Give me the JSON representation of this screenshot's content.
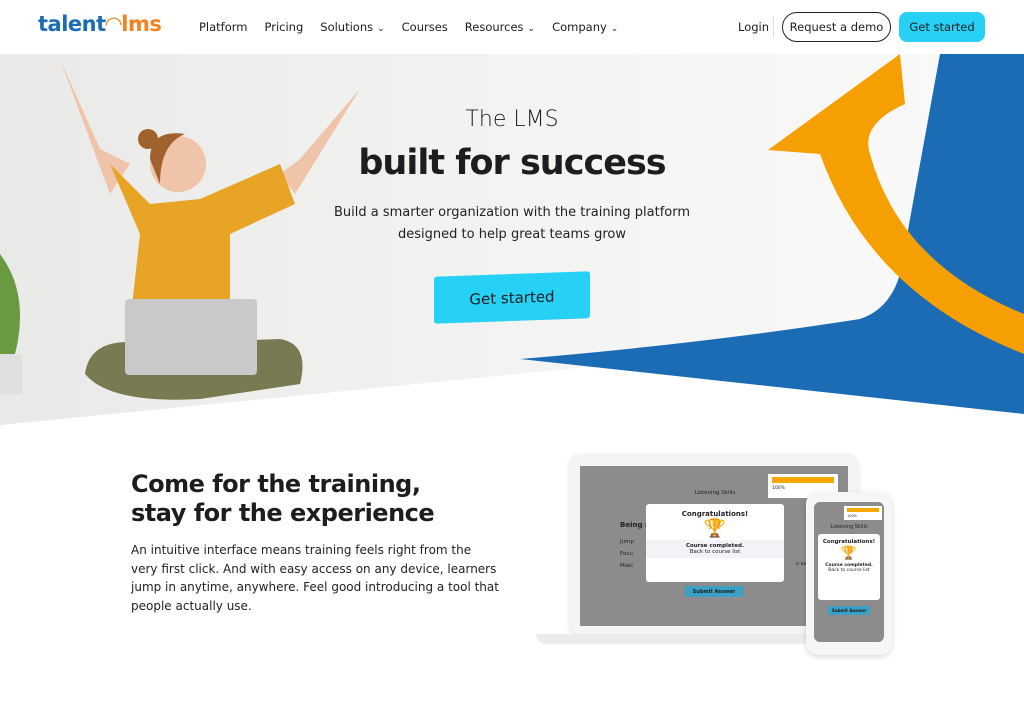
{
  "nav": {
    "logo_left": "talent",
    "logo_right": "lms",
    "items": [
      {
        "label": "Platform"
      },
      {
        "label": "Pricing"
      },
      {
        "label": "Solutions",
        "dropdown": true
      },
      {
        "label": "Courses"
      },
      {
        "label": "Resources",
        "dropdown": true
      },
      {
        "label": "Company",
        "dropdown": true
      }
    ],
    "login": "Login",
    "demo": "Request a demo",
    "get_started": "Get started"
  },
  "hero": {
    "title_light": "The LMS",
    "title_bold": "built for success",
    "subtitle": "Build a smarter organization with the training platform designed to help great teams grow",
    "cta": "Get started"
  },
  "section": {
    "heading_line1": "Come for the training,",
    "heading_line2": "stay for the experience",
    "body": "An intuitive interface means training feels right from the very first click. And with easy access on any device, learners jump in anytime, anywhere. Feel good introducing a tool that people actually use."
  },
  "mockup": {
    "course": "Listening Skills",
    "progress": "100%",
    "question": "Being a",
    "options": [
      "Jump",
      "Focu",
      "Maki"
    ],
    "option_tail": "s saying",
    "modal_title": "Congratulations!",
    "completed": "Course completed.",
    "back": "Back to course list",
    "submit": "Submit Answer"
  },
  "colors": {
    "accent": "#27d0f5",
    "blue": "#1b6cb5",
    "orange": "#f5a000"
  }
}
